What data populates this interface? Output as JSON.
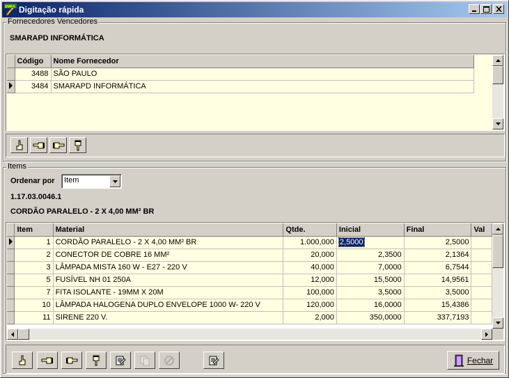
{
  "window": {
    "title": "Digitação rápida",
    "app_icon_text": "SMRA"
  },
  "suppliers_group": {
    "label": "Fornecedores Vencedores",
    "selected_name": "SMARAPD INFORMÁTICA",
    "columns": [
      "Código",
      "Nome Fornecedor"
    ],
    "rows": [
      {
        "code": "3488",
        "name": "SÃO PAULO"
      },
      {
        "code": "3484",
        "name": "SMARAPD INFORMÁTICA"
      }
    ]
  },
  "items_group": {
    "label": "Items",
    "order_label": "Ordenar por",
    "order_value": "Item",
    "item_code": "1.17.03.0046.1",
    "item_description": "CORDÃO PARALELO - 2 X 4,00 MM² BR",
    "columns": [
      "Item",
      "Material",
      "Qtde.",
      "Inicial",
      "Final",
      "Val"
    ],
    "rows": [
      {
        "item": "1",
        "material": "CORDÃO PARALELO - 2 X 4,00 MM² BR",
        "qtde": "1.000,000",
        "inicial": "2,5000",
        "final": "2,5000"
      },
      {
        "item": "2",
        "material": "CONECTOR DE COBRE 16 MM²",
        "qtde": "20,000",
        "inicial": "2,3500",
        "final": "2,1364"
      },
      {
        "item": "3",
        "material": "LÂMPADA MISTA 160 W - E27 - 220 V",
        "qtde": "40,000",
        "inicial": "7,0000",
        "final": "6,7544"
      },
      {
        "item": "5",
        "material": "FUSÍVEL NH 01 250A",
        "qtde": "12,000",
        "inicial": "15,5000",
        "final": "14,9561"
      },
      {
        "item": "7",
        "material": "FITA ISOLANTE - 19MM X 20M",
        "qtde": "100,000",
        "inicial": "3,5000",
        "final": "3,5000"
      },
      {
        "item": "10",
        "material": "LÂMPADA HALOGENA DUPLO ENVELOPE 1000 W- 220 V",
        "qtde": "120,000",
        "inicial": "16,0000",
        "final": "15,4386"
      },
      {
        "item": "11",
        "material": "SIRENE 220 V.",
        "qtde": "2,000",
        "inicial": "350,0000",
        "final": "337,7193"
      }
    ]
  },
  "footer": {
    "close_label": "Fechar"
  },
  "icons": [
    "hand-up-icon",
    "hand-left-icon",
    "hand-right-icon",
    "hand-down-icon",
    "edit-document-icon",
    "copy-document-icon",
    "cancel-icon",
    "close-door-icon"
  ],
  "colors": {
    "title_start": "#0a246a",
    "title_end": "#a6caf0",
    "grid_bg": "#ffffe1",
    "face": "#d4d0c8"
  }
}
